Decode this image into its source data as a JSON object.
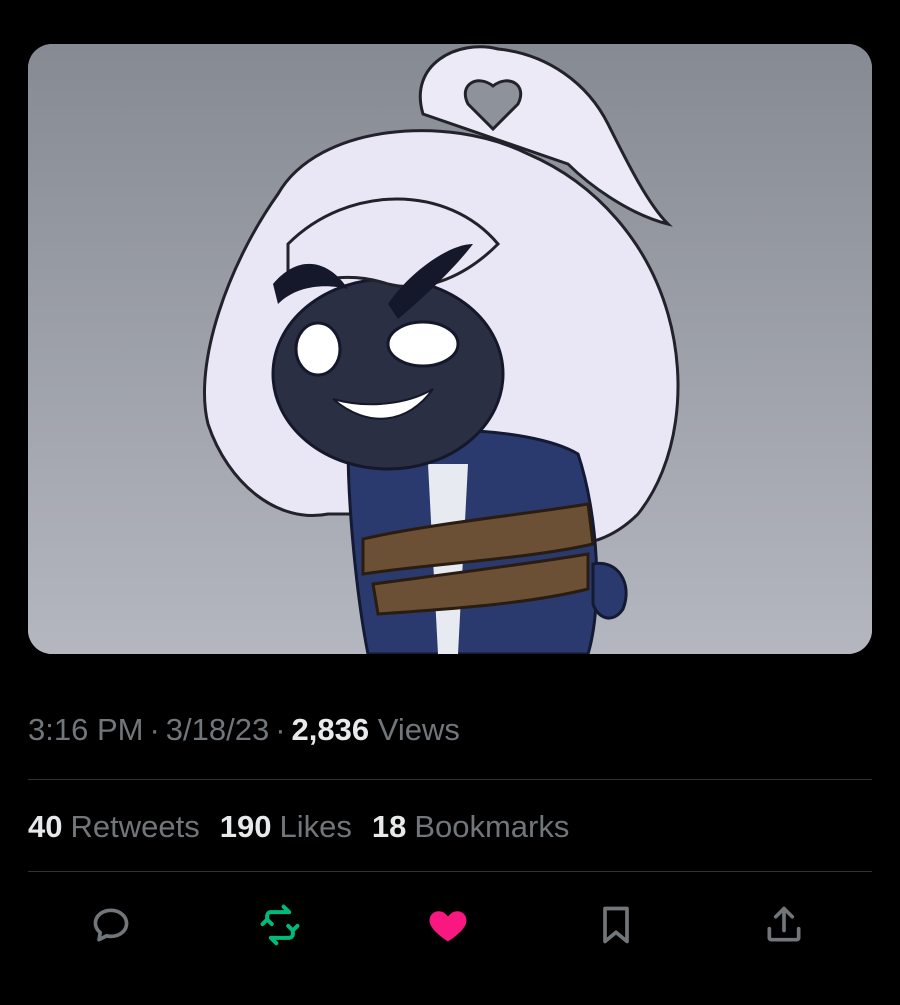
{
  "tweet": {
    "time": "3:16 PM",
    "date": "3/18/23",
    "separator": "·",
    "views_count": "2,836",
    "views_label": "Views",
    "media": {
      "alt_icon": "illustration-image"
    }
  },
  "stats": {
    "retweets": {
      "count": "40",
      "label": "Retweets"
    },
    "likes": {
      "count": "190",
      "label": "Likes"
    },
    "bookmarks": {
      "count": "18",
      "label": "Bookmarks"
    }
  },
  "actions": [
    {
      "name": "reply",
      "icon": "speech-bubble-icon",
      "color": "#71767b"
    },
    {
      "name": "retweet",
      "icon": "retweet-icon",
      "color": "#00ba7c"
    },
    {
      "name": "like",
      "icon": "heart-icon",
      "color": "#f91880"
    },
    {
      "name": "bookmark",
      "icon": "bookmark-icon",
      "color": "#71767b"
    },
    {
      "name": "share",
      "icon": "share-icon",
      "color": "#71767b"
    }
  ],
  "colors": {
    "background": "#000000",
    "text_primary": "#e7e9ea",
    "text_secondary": "#71767b",
    "divider": "#2f3336",
    "retweet_active": "#00ba7c",
    "like_active": "#f91880"
  }
}
